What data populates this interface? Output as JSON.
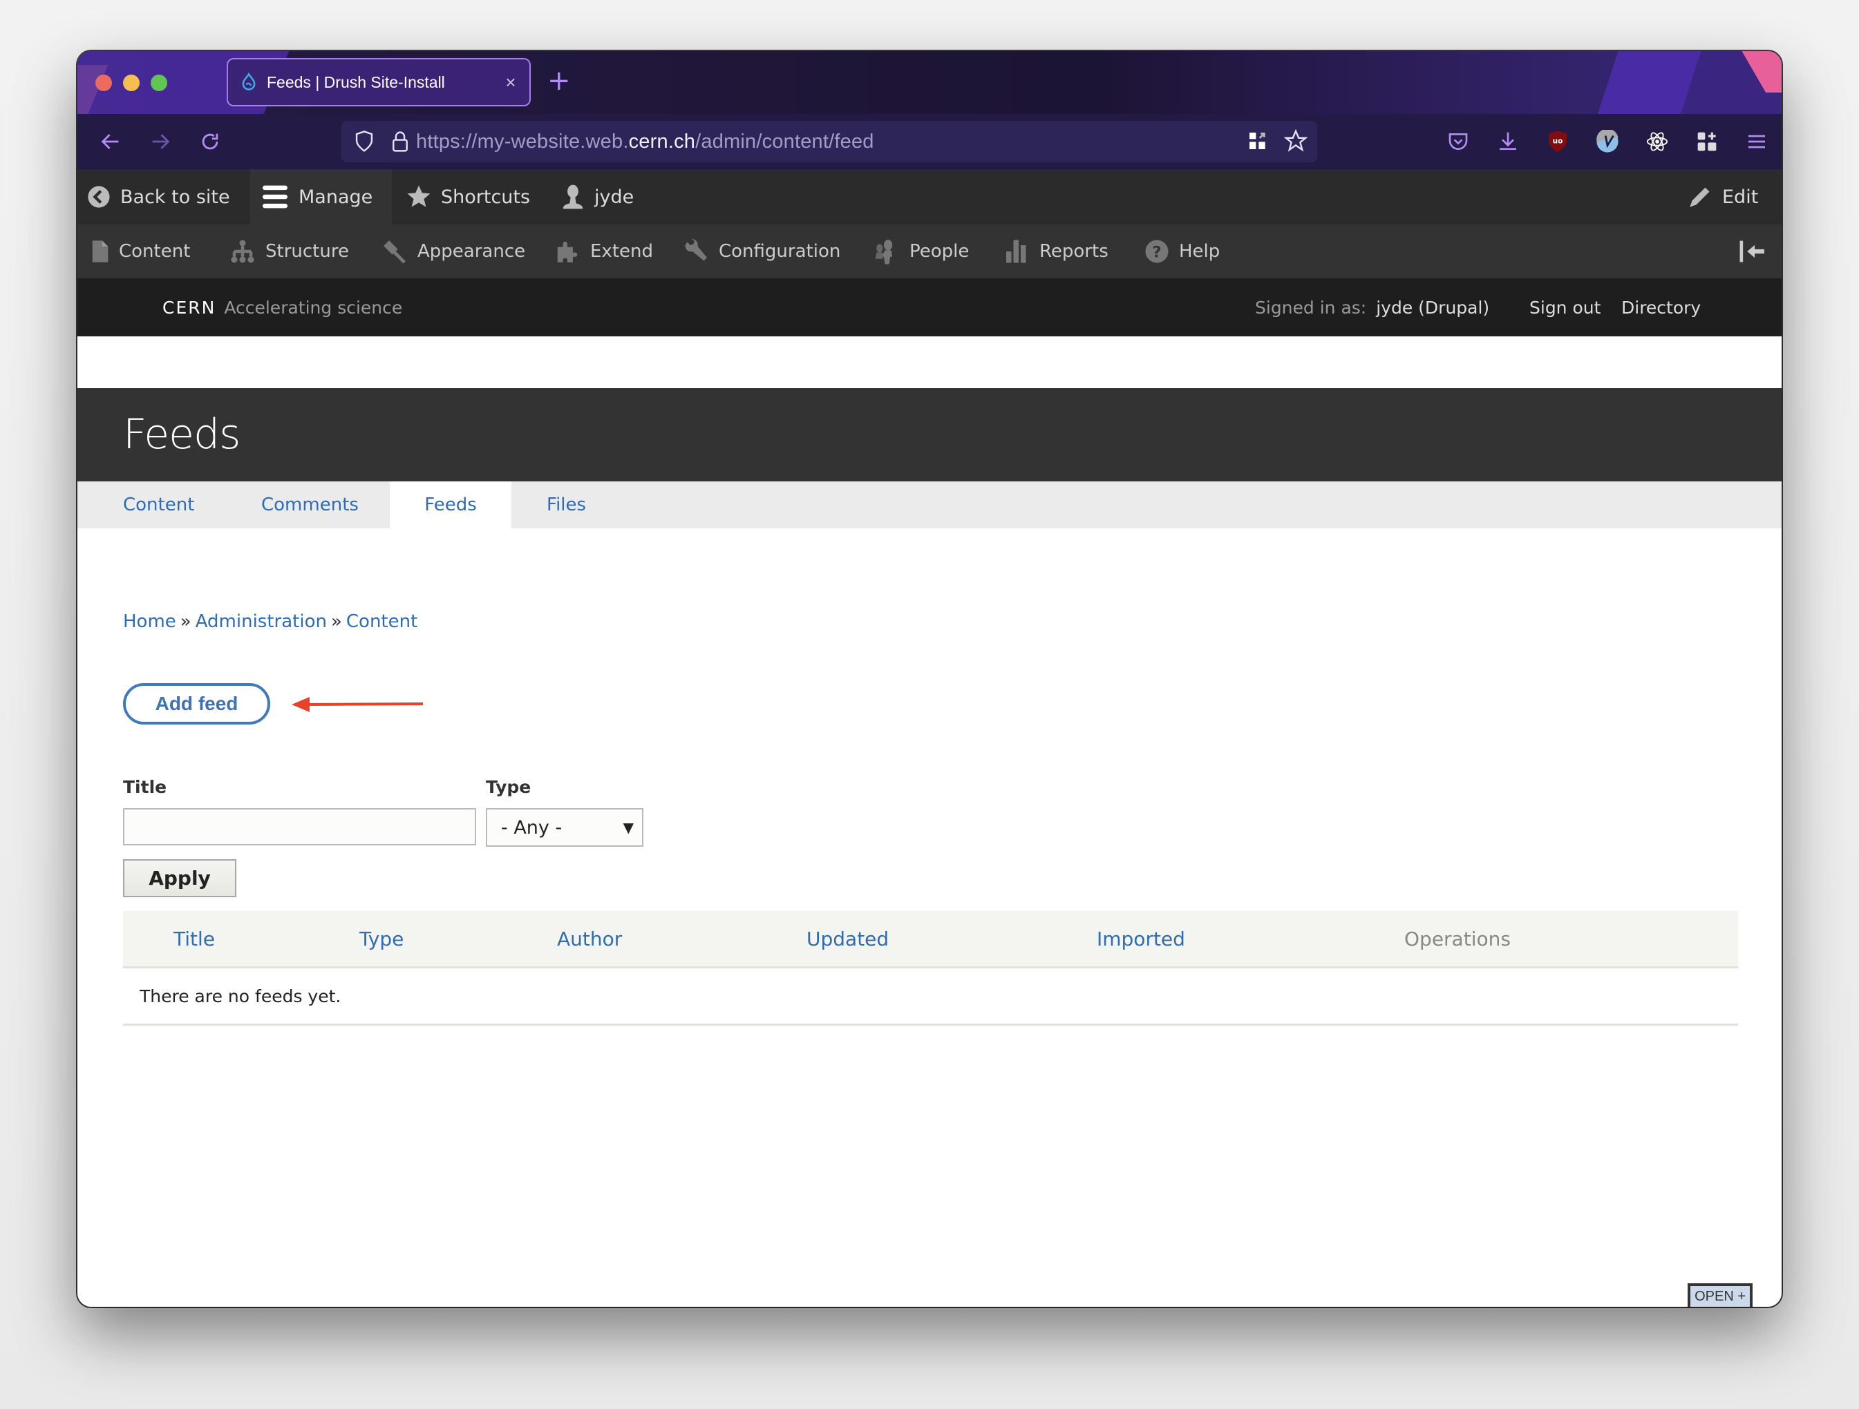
{
  "browser": {
    "tab": {
      "title": "Feeds | Drush Site-Install",
      "favicon": "drupal-drop-icon",
      "close": "×"
    },
    "new_tab": "+",
    "url": {
      "prefix": "https://my-website.web.",
      "domain": "cern.ch",
      "path": "/admin/content/feed"
    },
    "toolbar_icons": [
      "pocket-icon",
      "download-icon",
      "ublock-icon",
      "vimium-icon",
      "react-devtools-icon",
      "extensions-icon",
      "hamburger-menu-icon"
    ]
  },
  "drupal_toolbar": {
    "top": {
      "back_to_site": "Back to site",
      "manage": "Manage",
      "shortcuts": "Shortcuts",
      "user": "jyde",
      "edit": "Edit"
    },
    "menu": [
      {
        "label": "Content",
        "icon": "file-icon"
      },
      {
        "label": "Structure",
        "icon": "hierarchy-icon"
      },
      {
        "label": "Appearance",
        "icon": "paintbrush-icon"
      },
      {
        "label": "Extend",
        "icon": "puzzle-icon"
      },
      {
        "label": "Configuration",
        "icon": "wrench-icon"
      },
      {
        "label": "People",
        "icon": "people-icon"
      },
      {
        "label": "Reports",
        "icon": "bar-chart-icon"
      },
      {
        "label": "Help",
        "icon": "help-icon"
      }
    ]
  },
  "cern_bar": {
    "brand": "CERN",
    "tagline": "Accelerating science",
    "signed_in_label": "Signed in as:",
    "signed_in_user": "jyde (Drupal)",
    "sign_out": "Sign out",
    "directory": "Directory"
  },
  "page": {
    "title": "Feeds",
    "tabs": [
      {
        "label": "Content",
        "active": false
      },
      {
        "label": "Comments",
        "active": false
      },
      {
        "label": "Feeds",
        "active": true
      },
      {
        "label": "Files",
        "active": false
      }
    ],
    "breadcrumb": [
      "Home",
      "Administration",
      "Content"
    ],
    "breadcrumb_separator": "»",
    "add_button": "Add feed",
    "filters": {
      "title_label": "Title",
      "title_value": "",
      "type_label": "Type",
      "type_selected": "- Any -",
      "apply": "Apply"
    },
    "table": {
      "columns": [
        "Title",
        "Type",
        "Author",
        "Updated",
        "Imported",
        "Operations"
      ],
      "empty_message": "There are no feeds yet."
    },
    "open_plus": "OPEN +"
  },
  "colors": {
    "link": "#2e6db6",
    "annotation_arrow": "#e8432a",
    "header_dark": "#333333"
  }
}
